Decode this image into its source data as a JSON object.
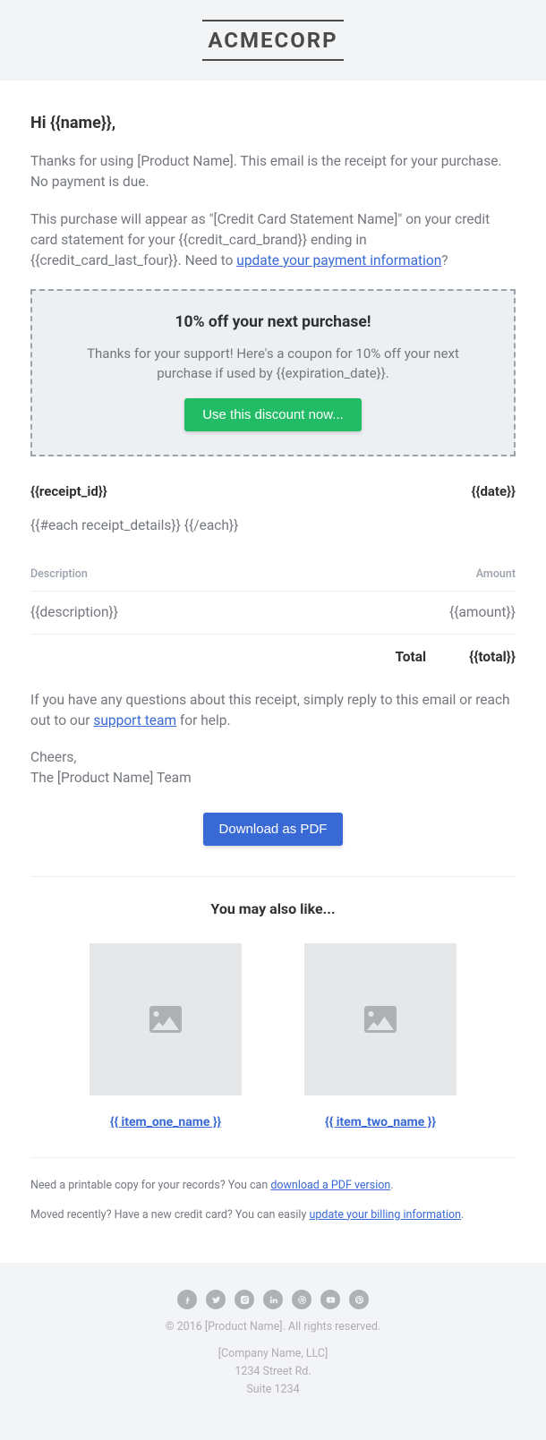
{
  "header": {
    "logo_text": "ACMECORP"
  },
  "greeting": "Hi {{name}},",
  "intro1": "Thanks for using [Product Name]. This email is the receipt for your purchase. No payment is due.",
  "intro2_before": "This purchase will appear as \"[Credit Card Statement Name]\" on your credit card statement for your {{credit_card_brand}} ending in {{credit_card_last_four}}. Need to ",
  "intro2_link": "update your payment information",
  "intro2_after": "?",
  "promo": {
    "title": "10% off your next purchase!",
    "text": "Thanks for your support! Here's a coupon for 10% off your next purchase if used by {{expiration_date}}.",
    "button": "Use this discount now..."
  },
  "receipt": {
    "id_label": "{{receipt_id}}",
    "date_label": "{{date}}",
    "each_text": "{{#each receipt_details}} {{/each}}",
    "col_description": "Description",
    "col_amount": "Amount",
    "row_description": "{{description}}",
    "row_amount": "{{amount}}",
    "total_label": "Total",
    "total_value": "{{total}}"
  },
  "help_before": "If you have any questions about this receipt, simply reply to this email or reach out to our ",
  "help_link": "support team",
  "help_after": " for help.",
  "signoff_line1": "Cheers,",
  "signoff_line2": "The [Product Name] Team",
  "download_button": "Download as PDF",
  "related": {
    "title": "You may also like...",
    "item1": "{{ item_one_name }}",
    "item2": "{{ item_two_name }}"
  },
  "sub": {
    "line1_before": "Need a printable copy for your records? You can ",
    "line1_link": "download a PDF version",
    "line1_after": ".",
    "line2_before": "Moved recently? Have a new credit card? You can easily ",
    "line2_link": "update your billing information",
    "line2_after": "."
  },
  "footer": {
    "copyright": "© 2016 [Product Name]. All rights reserved.",
    "company": "[Company Name, LLC]",
    "street": "1234 Street Rd.",
    "suite": "Suite 1234"
  }
}
